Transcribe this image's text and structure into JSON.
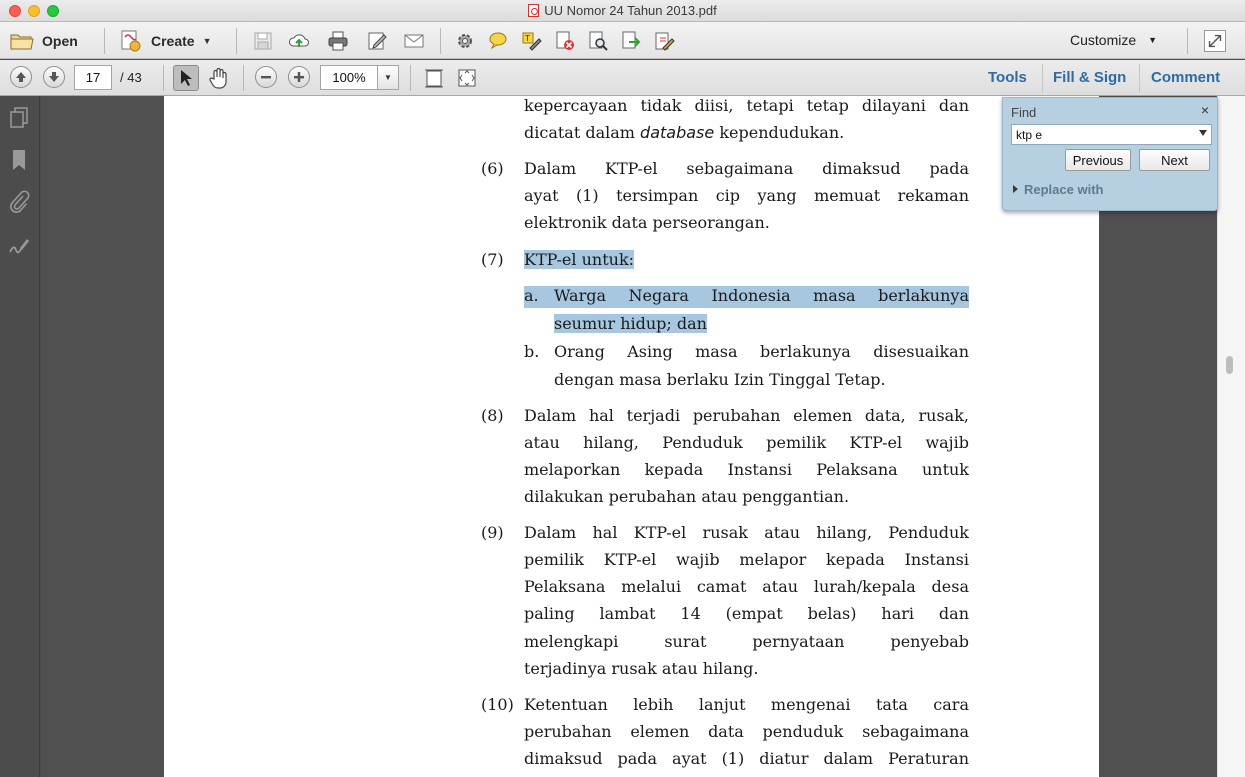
{
  "window": {
    "title": "UU Nomor 24 Tahun 2013.pdf"
  },
  "toolbar": {
    "open_label": "Open",
    "create_label": "Create",
    "customize_label": "Customize"
  },
  "nav": {
    "page_current": "17",
    "page_total": "/ 43",
    "zoom": "100%"
  },
  "panels": {
    "tools": "Tools",
    "fill_sign": "Fill & Sign",
    "comment": "Comment"
  },
  "find": {
    "title": "Find",
    "close": "×",
    "query": "ktp e",
    "previous": "Previous",
    "next": "Next",
    "replace_with": "Replace with"
  },
  "document": {
    "top_lines": [
      "kepercayaan tidak diisi, tetapi tetap dilayani dan",
      "dicatat dalam database kependudukan."
    ],
    "p6": {
      "num": "(6)",
      "lines": [
        "Dalam KTP-el sebagaimana dimaksud pada",
        "ayat (1) tersimpan cip yang memuat rekaman",
        "elektronik data perseorangan."
      ]
    },
    "p7": {
      "num": "(7)",
      "lines": [
        "KTP-el untuk:"
      ]
    },
    "p7a": {
      "letter": "a.",
      "lines": [
        "Warga Negara Indonesia masa berlakunya",
        "seumur hidup; dan"
      ]
    },
    "p7b": {
      "letter": "b.",
      "lines": [
        "Orang Asing masa berlakunya disesuaikan",
        "dengan masa berlaku Izin Tinggal Tetap."
      ]
    },
    "p8": {
      "num": "(8)",
      "lines": [
        "Dalam hal terjadi perubahan elemen data, rusak,",
        "atau hilang, Penduduk pemilik KTP-el wajib",
        "melaporkan kepada Instansi Pelaksana untuk",
        "dilakukan perubahan atau penggantian."
      ]
    },
    "p9": {
      "num": "(9)",
      "lines": [
        "Dalam hal KTP-el rusak atau hilang, Penduduk",
        "pemilik KTP-el wajib melapor kepada Instansi",
        "Pelaksana melalui camat atau lurah/kepala desa",
        "paling lambat 14 (empat belas) hari dan",
        "melengkapi surat pernyataan penyebab",
        "terjadinya rusak atau hilang."
      ]
    },
    "p10": {
      "num": "(10)",
      "lines": [
        "Ketentuan lebih lanjut mengenai tata cara",
        "perubahan elemen data penduduk sebagaimana",
        "dimaksud pada ayat (1) diatur dalam Peraturan"
      ]
    }
  },
  "icons": {
    "open": "folder-icon",
    "create": "create-pdf-icon",
    "save": "save-icon",
    "upload": "cloud-upload-icon",
    "print": "print-icon",
    "edit": "edit-icon",
    "mail": "mail-icon",
    "settings": "gear-icon",
    "comment": "speech-bubble-icon",
    "highlight": "highlight-icon",
    "fullscreen": "expand-icon"
  }
}
